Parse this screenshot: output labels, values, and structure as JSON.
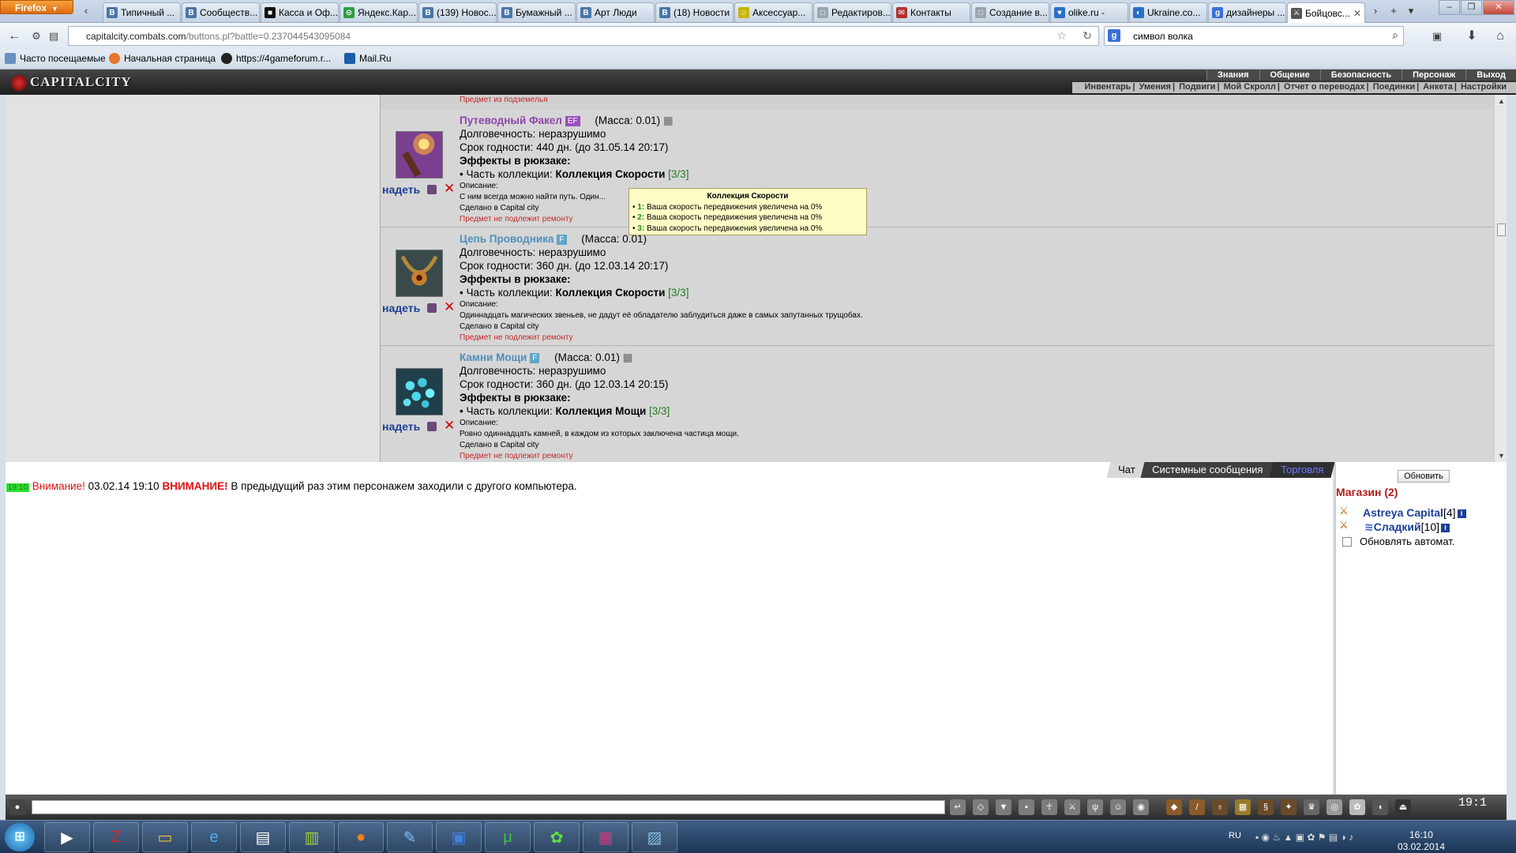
{
  "browser": {
    "menu_label": "Firefox",
    "tabs": [
      {
        "label": "Типичный ...",
        "icon": "В",
        "color": "#4a76a8"
      },
      {
        "label": "Сообществ...",
        "icon": "В",
        "color": "#4a76a8"
      },
      {
        "label": "Касса и Оф...",
        "icon": "■",
        "color": "#111111"
      },
      {
        "label": "Яндекс.Кар...",
        "icon": "⊙",
        "color": "#2f9e44"
      },
      {
        "label": "(139) Новос...",
        "icon": "В",
        "color": "#4a76a8"
      },
      {
        "label": "Бумажный ...",
        "icon": "В",
        "color": "#4a76a8"
      },
      {
        "label": "Арт Люди",
        "icon": "В",
        "color": "#4a76a8"
      },
      {
        "label": "(18) Новости",
        "icon": "В",
        "color": "#4a76a8"
      },
      {
        "label": "Аксессуар...",
        "icon": "☺",
        "color": "#c9b400"
      },
      {
        "label": "Редактиров...",
        "icon": "□",
        "color": "#9aa5b1"
      },
      {
        "label": "Контакты",
        "icon": "✉",
        "color": "#b03030"
      },
      {
        "label": "Создание в...",
        "icon": "□",
        "color": "#9aa5b1"
      },
      {
        "label": "olike.ru -",
        "icon": "♥",
        "color": "#2a6fc9"
      },
      {
        "label": "Ukraine.co...",
        "icon": "◐",
        "color": "#2a6fc9"
      },
      {
        "label": "дизайнеры ...",
        "icon": "g",
        "color": "#3a6fd8"
      },
      {
        "label": "Бойцовс...",
        "icon": "⚔",
        "color": "#555555"
      }
    ],
    "url_domain": "capitalcity.combats.com",
    "url_path": "/buttons.pl?battle=0.237044543095084",
    "search_value": "символ волка",
    "bookmarks": [
      "Часто посещаемые",
      "Начальная страница",
      "https://4gameforum.r...",
      "Mail.Ru"
    ]
  },
  "game": {
    "logo": "CAPITALCITY",
    "top_menu": [
      "Знания",
      "Общение",
      "Безопасность",
      "Персонаж",
      "Выход"
    ],
    "sub_menu": [
      "Инвентарь",
      "Умения",
      "Подвиги",
      "Мой Скролл",
      "Отчет о переводах",
      "Поединки",
      "Анкета",
      "Настройки"
    ],
    "top_cut_line": "Предмет из подземелья",
    "wear_label": "надеть",
    "items": [
      {
        "name": "Путеводный Факел",
        "badge": "EF",
        "badge_color": "#9a4fc0",
        "name_color": "#8e44ad",
        "mass": "(Масса: 0.01)",
        "durability": "Долговечность: неразрушимо",
        "expiry": "Срок годности: 440 дн. (до 31.05.14 20:17)",
        "effects_title": "Эффекты в рюкзаке:",
        "collection_prefix": "• Часть коллекции:",
        "collection": "Коллекция Скорости",
        "collection_count": "[3/3]",
        "desc_label": "Описание:",
        "desc": "С ним всегда можно найти путь. Один...",
        "made": "Сделано в Capital city",
        "repair": "Предмет не подлежит ремонту",
        "img": "torch"
      },
      {
        "name": "Цепь Проводника",
        "badge": "F",
        "badge_color": "#5fa6c8",
        "name_color": "#4f8fb8",
        "mass": "(Масса: 0.01)",
        "durability": "Долговечность: неразрушимо",
        "expiry": "Срок годности: 360 дн. (до 12.03.14 20:17)",
        "effects_title": "Эффекты в рюкзаке:",
        "collection_prefix": "• Часть коллекции:",
        "collection": "Коллекция Скорости",
        "collection_count": "[3/3]",
        "desc_label": "Описание:",
        "desc": "Одиннадцать магических звеньев, не дадут её обладателю заблудиться даже в самых запутанных трущобах.",
        "made": "Сделано в Capital city",
        "repair": "Предмет не подлежит ремонту",
        "img": "chain"
      },
      {
        "name": "Камни Мощи",
        "badge": "F",
        "badge_color": "#5fa6c8",
        "name_color": "#4f8fb8",
        "mass": "(Масса: 0.01)",
        "durability": "Долговечность: неразрушимо",
        "expiry": "Срок годности: 360 дн. (до 12.03.14 20:15)",
        "effects_title": "Эффекты в рюкзаке:",
        "collection_prefix": "• Часть коллекции:",
        "collection": "Коллекция Мощи",
        "collection_count": "[3/3]",
        "desc_label": "Описание:",
        "desc": "Ровно одиннадцать камней, в каждом из которых заключена частица мощи.",
        "made": "Сделано в Capital city",
        "repair": "Предмет не подлежит ремонту",
        "img": "stones"
      }
    ],
    "tooltip": {
      "title": "Коллекция Скорости",
      "lines": [
        {
          "n": "1:",
          "text": "Ваша скорость передвижения увеличена на 0%"
        },
        {
          "n": "2:",
          "text": "Ваша скорость передвижения увеличена на 0%"
        },
        {
          "n": "3:",
          "text": "Ваша скорость передвижения увеличена на 0%"
        }
      ]
    },
    "chat_tabs": [
      "Чат",
      "Системные сообщения",
      "Торговля"
    ],
    "chat_message": {
      "time": "19:10",
      "warn1": "Внимание!",
      "date": "03.02.14 19:10",
      "warn2": "ВНИМАНИЕ!",
      "text": "В предыдущий раз этим персонажем заходили с другого компьютера."
    },
    "refresh_label": "Обновить",
    "shops_title": "Магазин (2)",
    "shops": [
      {
        "name": "Astreya Capital",
        "level": "[4]"
      },
      {
        "name": "Сладкий",
        "level": "[10]"
      }
    ],
    "auto_update_label": "Обновлять автомат.",
    "clock": "19:1"
  },
  "taskbar": {
    "lang": "RU",
    "time": "16:10",
    "date": "03.02.2014"
  }
}
